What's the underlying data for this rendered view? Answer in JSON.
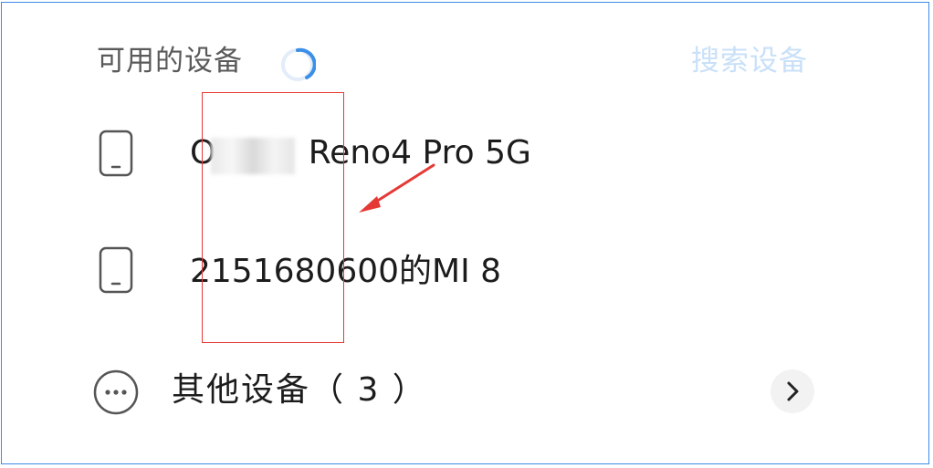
{
  "header": {
    "title": "可用的设备",
    "search_label": "搜索设备"
  },
  "devices": [
    {
      "name": "O Reno4 Pro 5G",
      "name_prefix": "O",
      "name_suffix": " Reno4 Pro 5G",
      "icon": "phone-icon"
    },
    {
      "name": "2151680600的MI 8",
      "icon": "phone-icon"
    }
  ],
  "other": {
    "label": "其他设备（ 3 ）",
    "icon": "more-icon",
    "chevron_icon": "chevron-right-icon"
  },
  "colors": {
    "frame_border": "#3d8be8",
    "accent_light": "#c9e0f8",
    "spinner": "#3b8fe6",
    "annotation_red": "#e53935"
  }
}
